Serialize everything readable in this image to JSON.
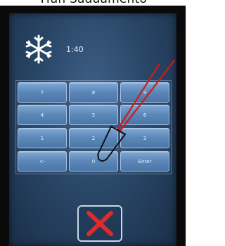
{
  "caption": "Tfan Saduamento",
  "status": {
    "timer": "1:40",
    "mode_icon": "snowflake-icon"
  },
  "keypad": {
    "keys": [
      {
        "label": "7"
      },
      {
        "label": "8"
      },
      {
        "label": "9"
      },
      {
        "label": "4"
      },
      {
        "label": "5"
      },
      {
        "label": "6"
      },
      {
        "label": "1"
      },
      {
        "label": "2"
      },
      {
        "label": "3"
      },
      {
        "label": "<-"
      },
      {
        "label": "0"
      },
      {
        "label": "Enter"
      }
    ]
  },
  "close_button": {
    "icon": "close-icon",
    "color": "#e02b2b"
  },
  "colors": {
    "screen": "#2a4768",
    "key": "#5a86b8",
    "probe": "#d11a1a"
  }
}
